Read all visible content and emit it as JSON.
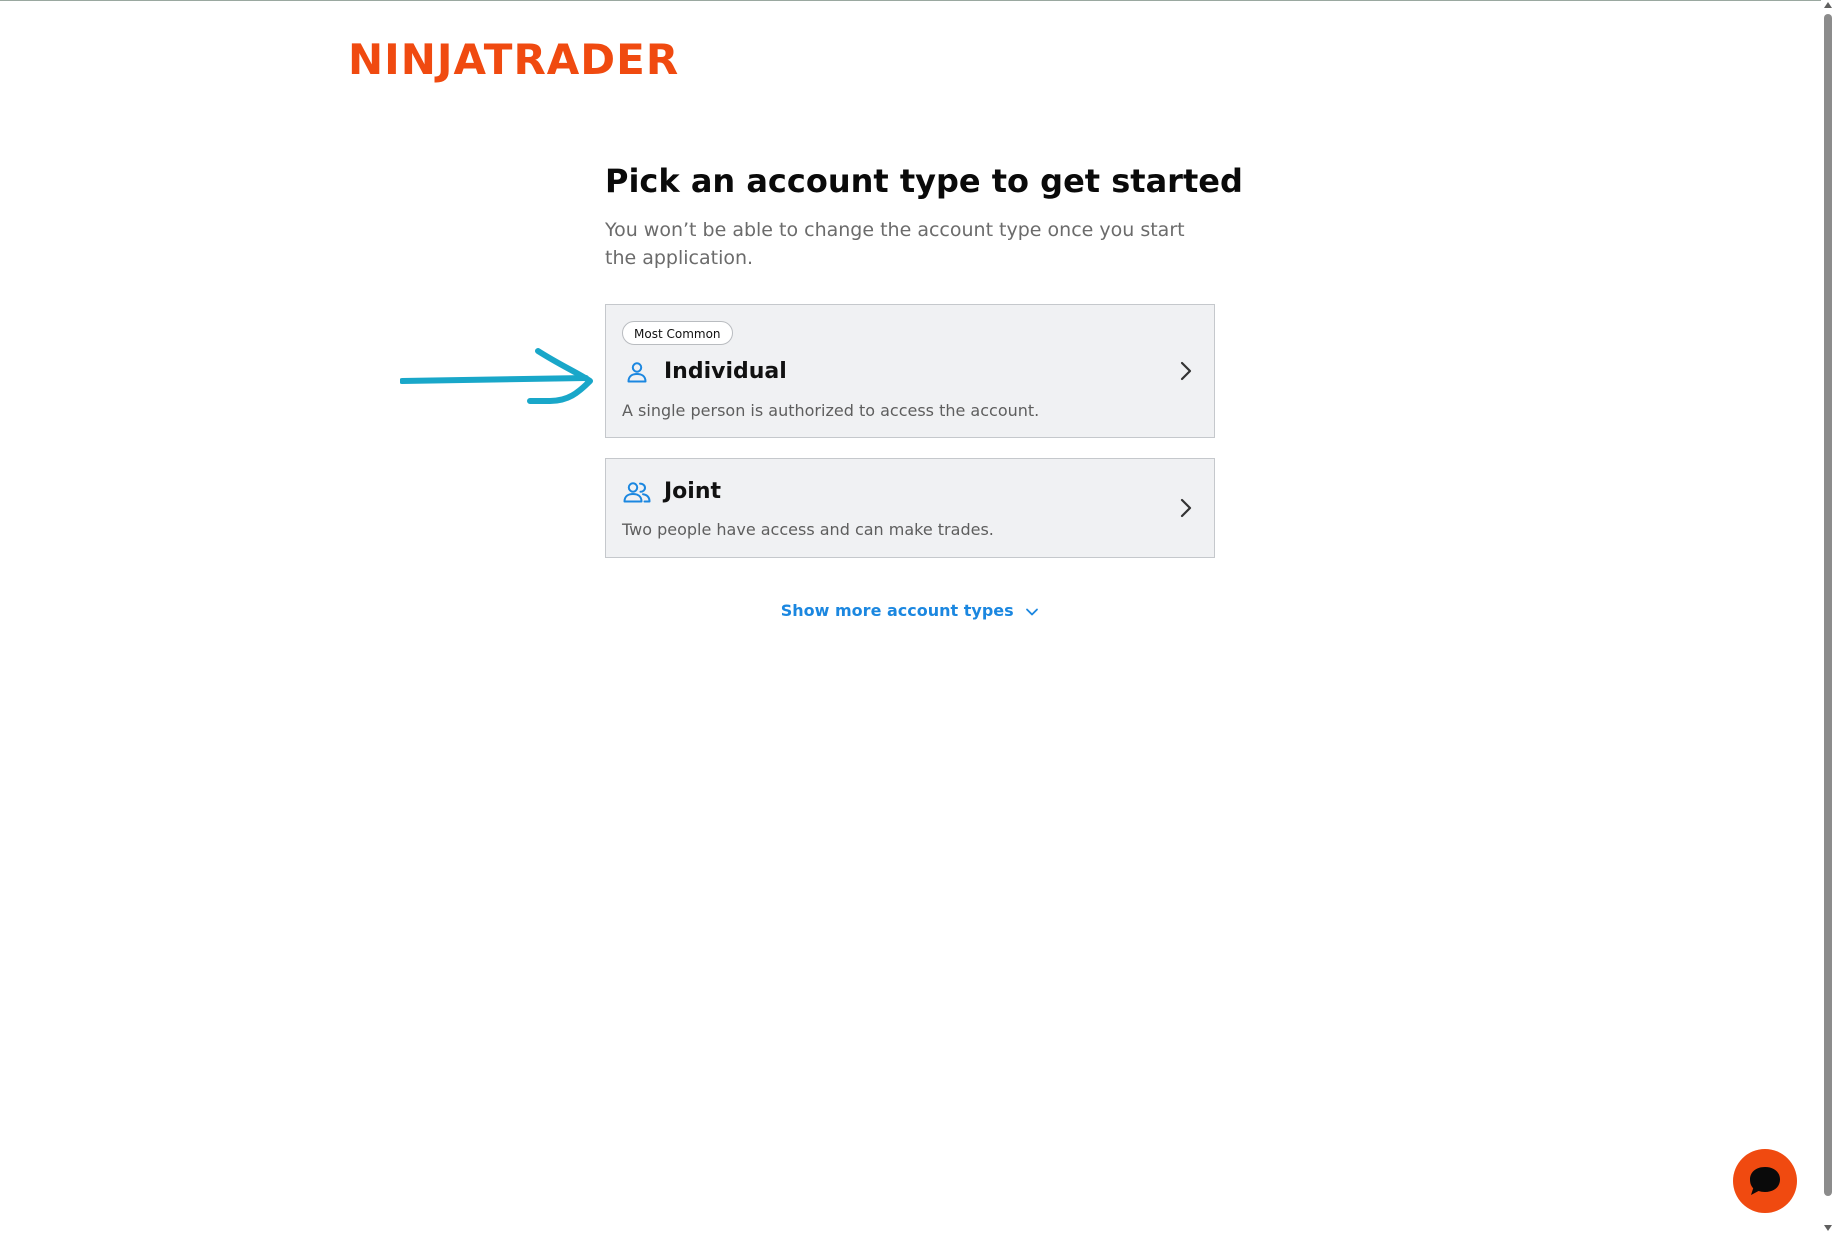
{
  "brand": {
    "logo_text": "NINJATRADER",
    "accent_color": "#f04a10",
    "link_color": "#1b87e0"
  },
  "main": {
    "title": "Pick an account type to get started",
    "subtitle": "You won’t be able to change the account type once you start the application."
  },
  "account_types": [
    {
      "badge": "Most Common",
      "title": "Individual",
      "description": "A single person is authorized to access the account.",
      "icon": "person-icon"
    },
    {
      "title": "Joint",
      "description": "Two people have access and can make trades.",
      "icon": "people-icon"
    }
  ],
  "show_more": {
    "label": "Show more account types",
    "icon": "chevron-down-icon"
  },
  "chat": {
    "icon": "chat-bubble-icon"
  },
  "annotation": {
    "icon": "arrow-right-icon",
    "color": "#19a7c9"
  }
}
